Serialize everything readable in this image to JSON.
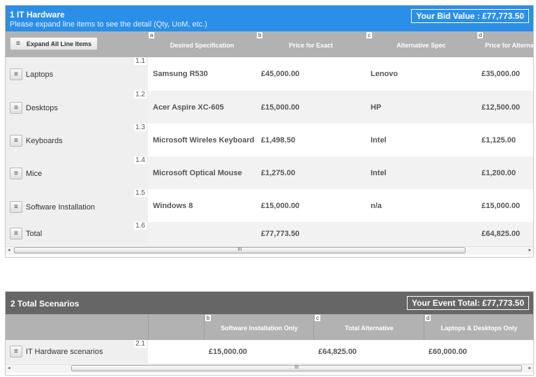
{
  "section1": {
    "title": "1 IT Hardware",
    "subtitle": "Please expand line items to see the detail (Qty, UoM, etc.)",
    "bid_value": "Your Bid Value : £77,773.50",
    "expand_label": "Expand All Line Items",
    "columns": [
      {
        "letter": "a",
        "label": "Desired Specification"
      },
      {
        "letter": "b",
        "label": "Price for Exact"
      },
      {
        "letter": "c",
        "label": "Alternative Spec"
      },
      {
        "letter": "d",
        "label": "Price for Alternative"
      }
    ],
    "rows": [
      {
        "num": "1.1",
        "name": "Laptops",
        "spec": "Samsung R530",
        "price_exact": "£45,000.00",
        "alt_spec": "Lenovo",
        "price_alt": "£35,000.00"
      },
      {
        "num": "1.2",
        "name": "Desktops",
        "spec": "Acer Aspire XC-605",
        "price_exact": "£15,000.00",
        "alt_spec": "HP",
        "price_alt": "£12,500.00"
      },
      {
        "num": "1.3",
        "name": "Keyboards",
        "spec": "Microsoft Wireles Keyboard",
        "price_exact": "£1,498.50",
        "alt_spec": "Intel",
        "price_alt": "£1,125.00"
      },
      {
        "num": "1.4",
        "name": "Mice",
        "spec": "Microsoft Optical Mouse",
        "price_exact": "£1,275.00",
        "alt_spec": "Intel",
        "price_alt": "£1,200.00"
      },
      {
        "num": "1.5",
        "name": "Software Installation",
        "spec": "Windows 8",
        "price_exact": "£15,000.00",
        "alt_spec": "n/a",
        "price_alt": "£15,000.00"
      },
      {
        "num": "1.6",
        "name": "Total",
        "spec": "",
        "price_exact": "£77,773.50",
        "alt_spec": "",
        "price_alt": "£64,825.00"
      }
    ],
    "scroll_grip": "III"
  },
  "section2": {
    "title": "2 Total Scenarios",
    "event_total": "Your Event Total: £77,773.50",
    "columns": [
      {
        "letter": "b",
        "label": "Software Installation Only"
      },
      {
        "letter": "c",
        "label": "Total Alternative"
      },
      {
        "letter": "d",
        "label": "Laptops & Desktops Only"
      }
    ],
    "rows": [
      {
        "num": "2.1",
        "name": "IT Hardware scenarios",
        "b": "£15,000.00",
        "c": "£64,825.00",
        "d": "£60,000.00"
      }
    ],
    "scroll_grip": "III"
  },
  "icons": {
    "line_item_icon": "list-detail-icon",
    "scroll_left": "◂",
    "scroll_right": "▸"
  }
}
